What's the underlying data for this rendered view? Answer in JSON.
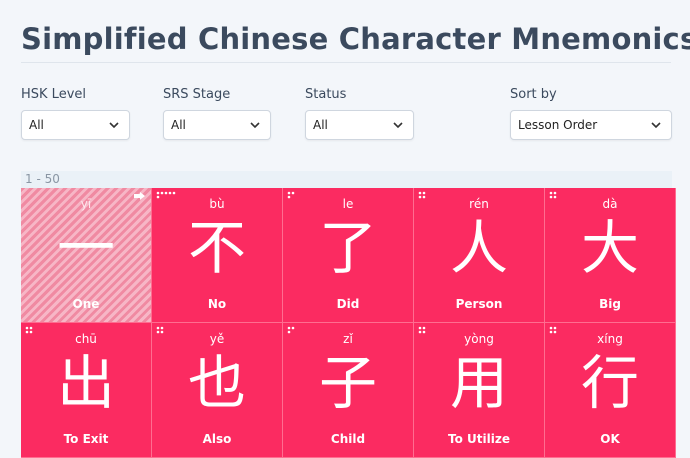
{
  "page": {
    "title": "Simplified Chinese Character Mnemonics"
  },
  "filters": [
    {
      "label": "HSK Level",
      "value": "All"
    },
    {
      "label": "SRS Stage",
      "value": "All"
    },
    {
      "label": "Status",
      "value": "All"
    },
    {
      "label": "Sort by",
      "value": "Lesson Order"
    }
  ],
  "range_label": "1 - 50",
  "cards": [
    {
      "pinyin": "yī",
      "hanzi": "一",
      "meaning": "One",
      "dots": 0,
      "striped": true,
      "arrow_icon": "next-arrow-icon"
    },
    {
      "pinyin": "bù",
      "hanzi": "不",
      "meaning": "No",
      "dots": 6
    },
    {
      "pinyin": "le",
      "hanzi": "了",
      "meaning": "Did",
      "dots": 3
    },
    {
      "pinyin": "rén",
      "hanzi": "人",
      "meaning": "Person",
      "dots": 4
    },
    {
      "pinyin": "dà",
      "hanzi": "大",
      "meaning": "Big",
      "dots": 4
    },
    {
      "pinyin": "chū",
      "hanzi": "出",
      "meaning": "To Exit",
      "dots": 4
    },
    {
      "pinyin": "yě",
      "hanzi": "也",
      "meaning": "Also",
      "dots": 4
    },
    {
      "pinyin": "zǐ",
      "hanzi": "子",
      "meaning": "Child",
      "dots": 3
    },
    {
      "pinyin": "yòng",
      "hanzi": "用",
      "meaning": "To Utilize",
      "dots": 4
    },
    {
      "pinyin": "xíng",
      "hanzi": "行",
      "meaning": "OK",
      "dots": 4
    }
  ],
  "colors": {
    "card": "#fb2b61",
    "title": "#3b4a5e",
    "background": "#f3f6fa"
  }
}
